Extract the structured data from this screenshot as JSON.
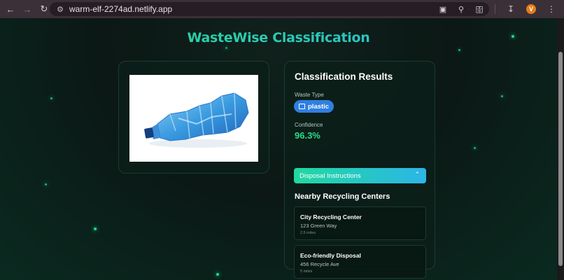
{
  "browser": {
    "url": "warm-elf-2274ad.netlify.app",
    "profile_initial": "V",
    "icons": [
      "back-arrow-icon",
      "forward-arrow-icon",
      "reload-icon",
      "site-info-icon",
      "cast-icon",
      "zoom-icon",
      "bookmark-star-icon",
      "extensions-icon",
      "download-icon",
      "menu-dots-icon"
    ]
  },
  "app": {
    "title": "WasteWise Classification",
    "accent_green": "#27dd8a",
    "accent_blue": "#2fb7e0"
  },
  "results": {
    "heading": "Classification Results",
    "waste_type_label": "Waste Type",
    "waste_type": "plastic",
    "confidence_label": "Confidence",
    "confidence": "96.3%",
    "disposal_label": "Disposal Instructions",
    "nearby_heading": "Nearby Recycling Centers",
    "centers": [
      {
        "name": "City Recycling Center",
        "address": "123 Green Way",
        "distance": "2.5 miles"
      },
      {
        "name": "Eco-friendly Disposal",
        "address": "456 Recycle Ave",
        "distance": "5 miles"
      }
    ]
  }
}
